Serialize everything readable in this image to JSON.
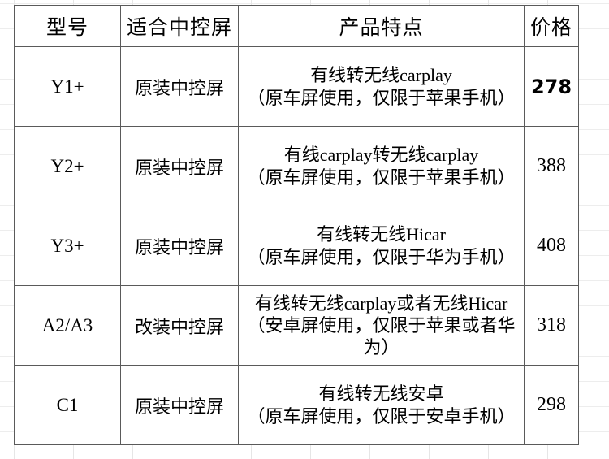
{
  "table": {
    "columns": [
      {
        "key": "model",
        "label": "型号"
      },
      {
        "key": "screen",
        "label": "适合中控屏"
      },
      {
        "key": "feature",
        "label": "产品特点"
      },
      {
        "key": "price",
        "label": "价格"
      }
    ],
    "rows": [
      {
        "model": "Y1+",
        "screen": "原装中控屏",
        "feature_line1": "有线转无线carplay",
        "feature_line2": "（原车屏使用，仅限于苹果手机）",
        "price": "278",
        "price_emphasis": "bold"
      },
      {
        "model": "Y2+",
        "screen": "原装中控屏",
        "feature_line1": "有线carplay转无线carplay",
        "feature_line2": "（原车屏使用，仅限于苹果手机）",
        "price": "388",
        "price_emphasis": "normal"
      },
      {
        "model": "Y3+",
        "screen": "原装中控屏",
        "feature_line1": "有线转无线Hicar",
        "feature_line2": "（原车屏使用，仅限于华为手机）",
        "price": "408",
        "price_emphasis": "normal"
      },
      {
        "model": "A2/A3",
        "screen": "改装中控屏",
        "feature_line1": "有线转无线carplay或者无线Hicar",
        "feature_line2": "（安卓屏使用，仅限于苹果或者华为）",
        "price": "318",
        "price_emphasis": "normal"
      },
      {
        "model": "C1",
        "screen": "原装中控屏",
        "feature_line1": "有线转无线安卓",
        "feature_line2": "（原车屏使用，仅限于安卓手机）",
        "price": "298",
        "price_emphasis": "normal"
      }
    ]
  },
  "colors": {
    "border": "#5a5a5a",
    "grid_line": "#e6e6e6",
    "text": "#000000",
    "background": "#ffffff"
  }
}
